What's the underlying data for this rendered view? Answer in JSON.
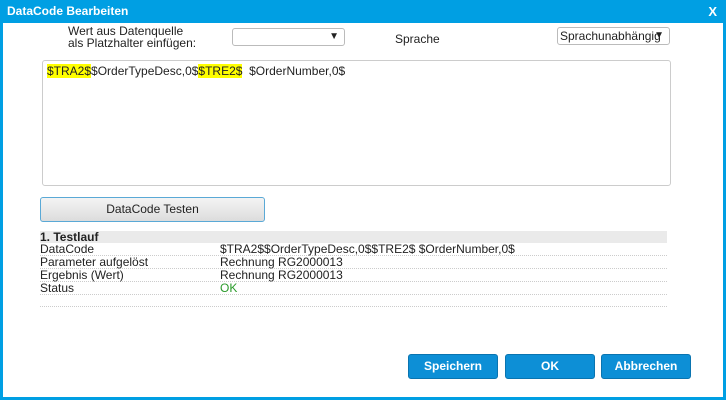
{
  "dialog": {
    "title": "DataCode Bearbeiten",
    "close_icon": "x-icon"
  },
  "form": {
    "placeholder_label": "Wert aus Datenquelle als Platzhalter einfügen:",
    "placeholder_select_value": "",
    "language_label": "Sprache",
    "language_select_value": "Sprachunabhängig"
  },
  "editor": {
    "segments": [
      {
        "text": "$TRA2$",
        "highlight": true
      },
      {
        "text": "$OrderTypeDesc,0$",
        "highlight": false
      },
      {
        "text": "$TRE2$",
        "highlight": true
      },
      {
        "text": "  $OrderNumber,0$",
        "highlight": false
      }
    ],
    "highlight_color": "#ffff00"
  },
  "test_button": "DataCode Testen",
  "results": {
    "heading": "1. Testlauf",
    "rows": [
      {
        "key": "DataCode",
        "value": "$TRA2$$OrderTypeDesc,0$$TRE2$ $OrderNumber,0$"
      },
      {
        "key": "Parameter aufgelöst",
        "value": "Rechnung RG2000013"
      },
      {
        "key": "Ergebnis (Wert)",
        "value": "Rechnung RG2000013"
      },
      {
        "key": "Status",
        "value": "OK"
      }
    ]
  },
  "footer": {
    "save": "Speichern",
    "ok": "OK",
    "cancel": "Abbrechen"
  },
  "colors": {
    "accent": "#009fe3",
    "button": "#0d8fd6",
    "status_ok": "#2a9a2a"
  }
}
